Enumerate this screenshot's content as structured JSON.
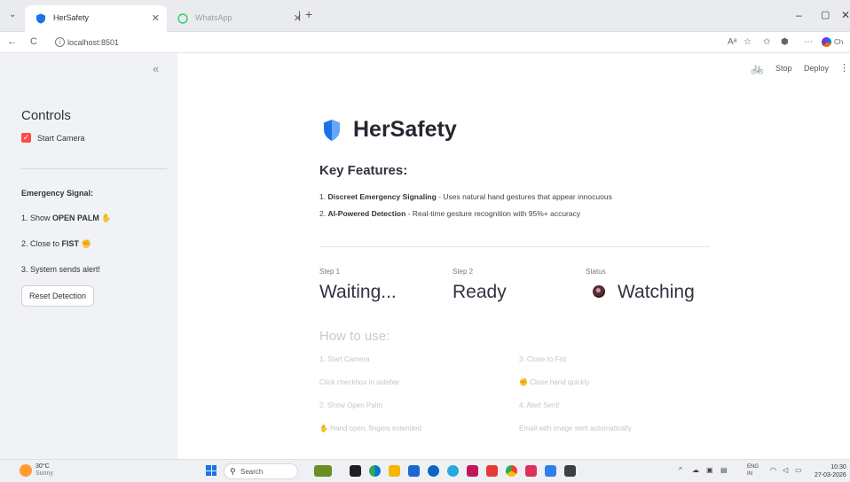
{
  "browser": {
    "tabs": [
      {
        "title": "HerSafety",
        "active": true
      },
      {
        "title": "WhatsApp",
        "active": false
      }
    ],
    "url": "localhost:8501",
    "profile_label": "Ch"
  },
  "toolbar": {
    "stop_label": "Stop",
    "deploy_label": "Deploy"
  },
  "sidebar": {
    "collapse_glyph": "«",
    "title": "Controls",
    "checkbox_label": "Start Camera",
    "signal_title": "Emergency Signal:",
    "steps": [
      {
        "prefix": "1. Show ",
        "bold": "OPEN PALM",
        "emoji": "✋"
      },
      {
        "prefix": "2. Close to ",
        "bold": "FIST",
        "emoji": "✊"
      },
      {
        "prefix": "3. System sends alert!",
        "bold": "",
        "emoji": ""
      }
    ],
    "reset_label": "Reset Detection"
  },
  "main": {
    "app_title": "HerSafety",
    "features_title": "Key Features:",
    "features": [
      {
        "num": "1.",
        "bold": "Discreet Emergency Signaling",
        "text": " - Uses natural hand gestures that appear innocuous"
      },
      {
        "num": "2.",
        "bold": "AI-Powered Detection",
        "text": " - Real-time gesture recognition with 95%+ accuracy"
      }
    ],
    "metrics": [
      {
        "label": "Step 1",
        "value": "Waiting..."
      },
      {
        "label": "Step 2",
        "value": "Ready"
      },
      {
        "label": "Status",
        "value": "Watching"
      }
    ],
    "howto_title": "How to use:",
    "howto": [
      {
        "title": "1. Start Camera",
        "desc": "Click checkbox in sidebar"
      },
      {
        "title": "2. Show Open Palm",
        "desc": "✋ Hand open, fingers extended"
      },
      {
        "title": "3. Close to Fist",
        "desc": "✊ Close hand quickly"
      },
      {
        "title": "4. Alert Sent!",
        "desc": "Email with image sent automatically"
      }
    ]
  },
  "taskbar": {
    "temperature": "30°C",
    "weather": "Sunny",
    "search_label": "Search",
    "lang": "ENG",
    "region": "IN",
    "time": "10:30",
    "date": "27-03-2026"
  },
  "colors": {
    "accent": "#ff4b4b",
    "sidebar_bg": "#f0f2f6",
    "shield": "#1a73e8"
  }
}
